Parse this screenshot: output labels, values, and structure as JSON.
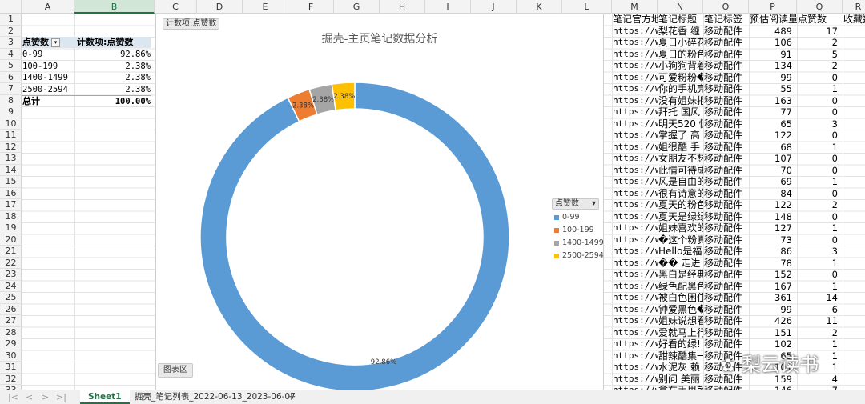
{
  "columns": [
    "A",
    "B",
    "C",
    "D",
    "E",
    "F",
    "G",
    "H",
    "I",
    "J",
    "K",
    "L",
    "M",
    "N",
    "O",
    "P",
    "Q",
    "R"
  ],
  "selected_column": "B",
  "rows": [
    "1",
    "2",
    "3",
    "4",
    "5",
    "6",
    "7",
    "8",
    "9",
    "10",
    "11",
    "12",
    "13",
    "14",
    "15",
    "16",
    "17",
    "18",
    "19",
    "20",
    "21",
    "22",
    "23",
    "24",
    "25",
    "26",
    "27",
    "28",
    "29",
    "30",
    "31",
    "32",
    "33"
  ],
  "pivot": {
    "header_label": "点赞数",
    "header_value": "计数项:点赞数",
    "rows": [
      {
        "label": "0-99",
        "value": "92.86%"
      },
      {
        "label": "100-199",
        "value": "2.38%"
      },
      {
        "label": "1400-1499",
        "value": "2.38%"
      },
      {
        "label": "2500-2594",
        "value": "2.38%"
      }
    ],
    "total_label": "总计",
    "total_value": "100.00%"
  },
  "chart": {
    "field_button": "计数项:点赞数",
    "title": "掘壳-主页笔记数据分析",
    "legend_field": "点赞数",
    "area_button": "图表区",
    "colors": [
      "#5b9bd5",
      "#ed7d31",
      "#a5a5a5",
      "#ffc000"
    ]
  },
  "chart_data": {
    "type": "pie",
    "donut": true,
    "title": "掘壳-主页笔记数据分析",
    "categories": [
      "0-99",
      "100-199",
      "1400-1499",
      "2500-2594"
    ],
    "values": [
      92.86,
      2.38,
      2.38,
      2.38
    ],
    "labels": [
      "92.86%",
      "2.38%",
      "2.38%",
      "2.38%"
    ],
    "legend_position": "right"
  },
  "table": {
    "headers": [
      "笔记官方地",
      "笔记标题",
      "笔记标签",
      "预估阅读量",
      "点赞数",
      "收藏数"
    ],
    "rows": [
      [
        "https://w",
        "梨花香 缠",
        "移动配件",
        "489",
        "17"
      ],
      [
        "https://w",
        "夏日小碎花",
        "移动配件",
        "106",
        "2"
      ],
      [
        "https://w",
        "夏日的粉色",
        "移动配件",
        "91",
        "5"
      ],
      [
        "https://w",
        "小狗狗背着",
        "移动配件",
        "134",
        "2"
      ],
      [
        "https://w",
        "可爱粉粉�",
        "移动配件",
        "99",
        "0"
      ],
      [
        "https://w",
        "你的手机壳",
        "移动配件",
        "55",
        "1"
      ],
      [
        "https://w",
        "没有姐妹拒",
        "移动配件",
        "163",
        "0"
      ],
      [
        "https://w",
        "拜托 国风",
        "移动配件",
        "77",
        "0"
      ],
      [
        "https://w",
        "明天520 恒",
        "移动配件",
        "65",
        "3"
      ],
      [
        "https://w",
        "掌握了 高",
        "移动配件",
        "122",
        "0"
      ],
      [
        "https://w",
        "姐很酷 手",
        "移动配件",
        "68",
        "1"
      ],
      [
        "https://w",
        "女朋友不想",
        "移动配件",
        "107",
        "0"
      ],
      [
        "https://w",
        "此情可待成",
        "移动配件",
        "70",
        "0"
      ],
      [
        "https://w",
        "风是自由的",
        "移动配件",
        "69",
        "1"
      ],
      [
        "https://w",
        "很有诗意的",
        "移动配件",
        "84",
        "0"
      ],
      [
        "https://w",
        "夏天的粉色",
        "移动配件",
        "122",
        "2"
      ],
      [
        "https://w",
        "夏天是绿绿",
        "移动配件",
        "148",
        "0"
      ],
      [
        "https://w",
        "姐妹喜欢的",
        "移动配件",
        "127",
        "1"
      ],
      [
        "https://w",
        "�这个粉真",
        "移动配件",
        "73",
        "0"
      ],
      [
        "https://w",
        "Hello是福",
        "移动配件",
        "86",
        "3"
      ],
      [
        "https://w",
        "�� 走进",
        "移动配件",
        "78",
        "1"
      ],
      [
        "https://w",
        "黑白是经典",
        "移动配件",
        "152",
        "0"
      ],
      [
        "https://w",
        "绿色配黑色",
        "移动配件",
        "167",
        "1"
      ],
      [
        "https://w",
        "被白色困住",
        "移动配件",
        "361",
        "14"
      ],
      [
        "https://w",
        "钟爱黑色�",
        "移动配件",
        "99",
        "6"
      ],
      [
        "https://w",
        "姐妹说想看",
        "移动配件",
        "426",
        "11"
      ],
      [
        "https://w",
        "爱就马上行",
        "移动配件",
        "151",
        "2"
      ],
      [
        "https://w",
        "好看的绿!",
        "移动配件",
        "102",
        "1"
      ],
      [
        "https://w",
        "甜辣酷集一",
        "移动配件",
        "65",
        "1"
      ],
      [
        "https://w",
        "水泥灰 赖",
        "移动配件",
        "101",
        "1"
      ],
      [
        "https://w",
        "别问 美丽",
        "移动配件",
        "159",
        "4"
      ],
      [
        "https://w",
        "拿在手里就",
        "移动配件",
        "146",
        "7"
      ]
    ]
  },
  "sheets": [
    "Sheet1",
    "掘壳_笔记列表_2022-06-13_2023-06-07"
  ],
  "active_sheet": "Sheet1",
  "add_sheet": "+",
  "nav": [
    "|<",
    "<",
    ">",
    ">|"
  ],
  "watermark": "梨云读书"
}
